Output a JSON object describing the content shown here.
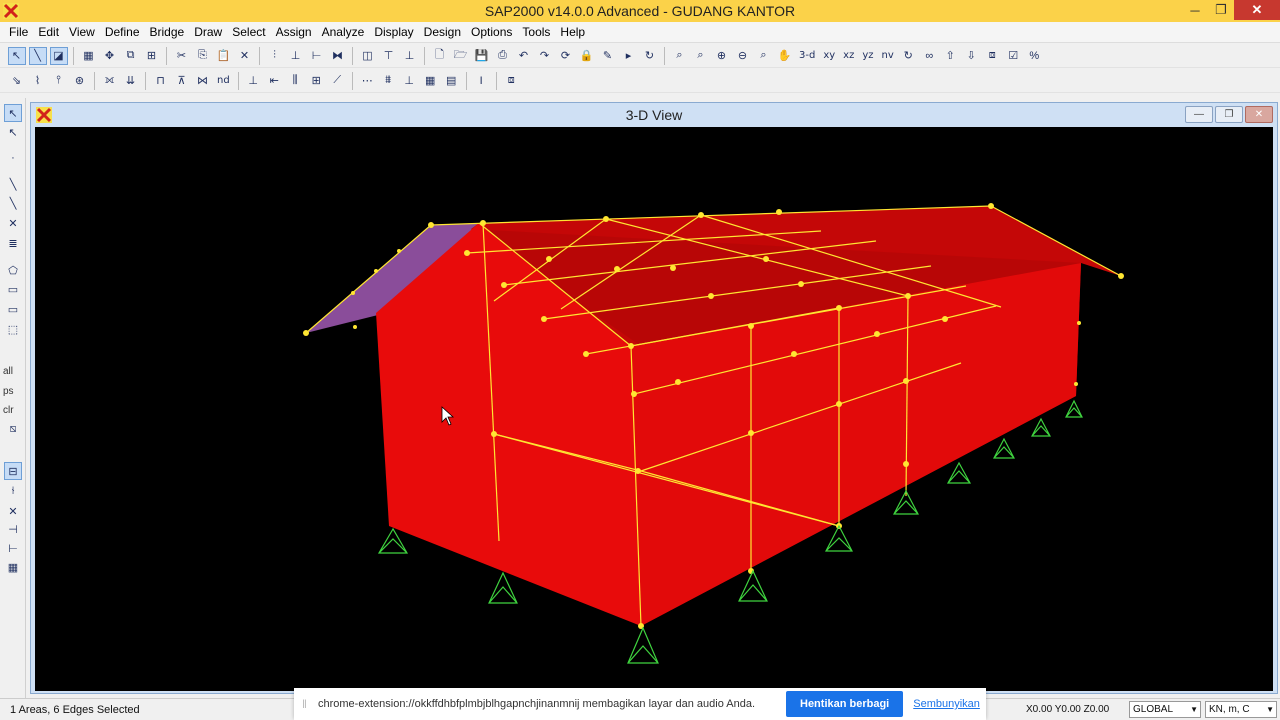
{
  "window": {
    "title": "SAP2000 v14.0.0 Advanced  - GUDANG KANTOR",
    "minimize": "─",
    "restore": "❐",
    "close": "✕"
  },
  "menu": [
    "File",
    "Edit",
    "View",
    "Define",
    "Bridge",
    "Draw",
    "Select",
    "Assign",
    "Analyze",
    "Display",
    "Design",
    "Options",
    "Tools",
    "Help"
  ],
  "toolbar": {
    "view_3d": "3-d",
    "view_xy": "xy",
    "view_xz": "xz",
    "view_yz": "yz",
    "view_nv": "nv",
    "view_nd": "nd"
  },
  "left_toolbar": {
    "all": "all",
    "ps": "ps",
    "clr": "clr"
  },
  "view_window": {
    "title": "3-D View",
    "minimize": "—",
    "restore": "❐",
    "close": "✕"
  },
  "status": {
    "selection": "1 Areas, 6 Edges Selected",
    "coords": "X0.00  Y0.00  Z0.00",
    "coord_system": "GLOBAL",
    "units": "KN, m, C"
  },
  "share_banner": {
    "message": "chrome-extension://okkffdhbfplmbjblhgapnchjinanmnij membagikan layar dan audio Anda.",
    "stop_label": "Hentikan berbagi",
    "hide_label": "Sembunyikan"
  },
  "colors": {
    "title_bar": "#fbd249",
    "wall": "#e80b0b",
    "roof": "#c40707",
    "frame": "#ffe632",
    "support": "#3fd33f",
    "gable_left": "#8a4d9a",
    "canvas": "#000000"
  }
}
